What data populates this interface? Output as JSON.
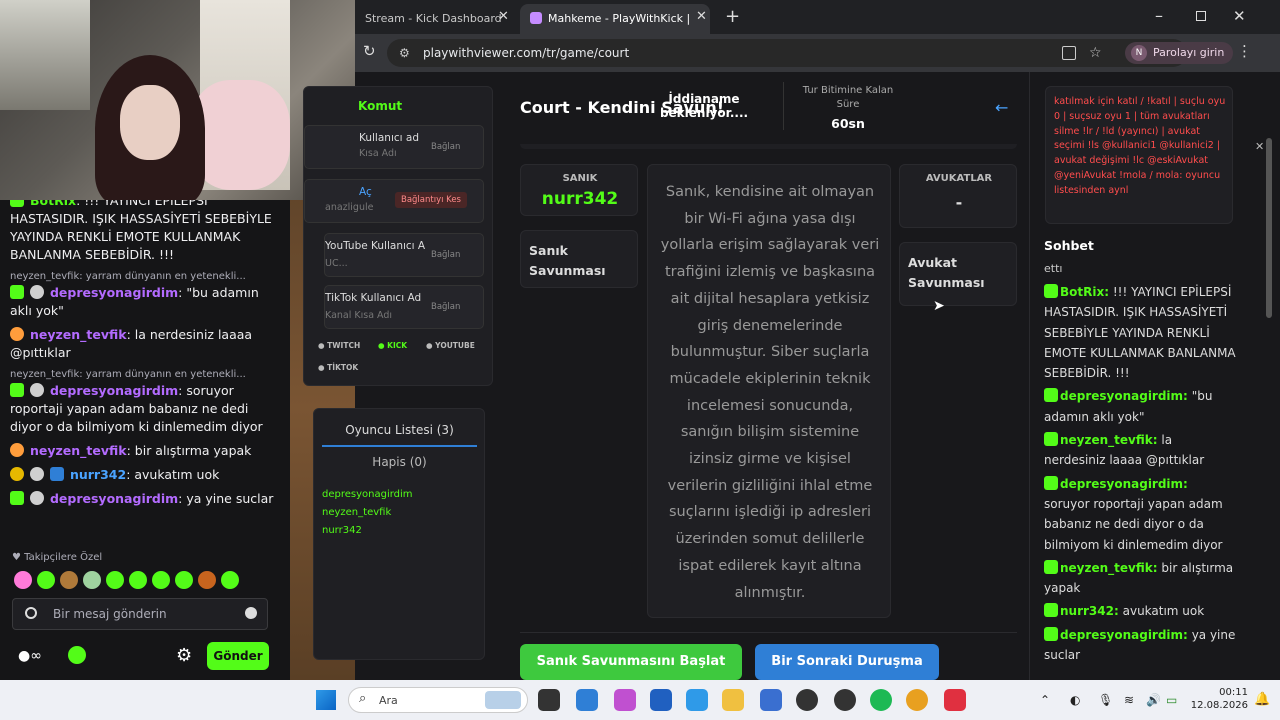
{
  "stream_chat": {
    "messages": [
      {
        "user": "BotRix",
        "text": "!!! YAYINCI EPİLEPSİ HASTASIDIR. IŞIK HASSASİYETİ SEBEBİYLE YAYINDA RENKLİ EMOTE KULLANMAK BANLANMA SEBEBİDİR. !!!"
      },
      {
        "reply": "neyzen_tevfik: yarram dünyanın en yetenekli...",
        "user": "depresyonagirdim",
        "text": "\"bu adamın aklı yok\""
      },
      {
        "user": "neyzen_tevfik",
        "text": "la nerdesiniz laaaa @pıttıklar"
      },
      {
        "reply": "neyzen_tevfik: yarram dünyanın en yetenekli...",
        "user": "depresyonagirdim",
        "text": "soruyor roportaji yapan adam babanız ne dedi diyor o da bilmiyom ki dinlemedim diyor"
      },
      {
        "user": "neyzen_tevfik",
        "text": "bir alıştırma yapak"
      },
      {
        "user": "nurr342",
        "text": "avukatım uok"
      },
      {
        "user": "depresyonagirdim",
        "text": "ya yine suclar"
      }
    ],
    "followers_only": "Takipçilere Özel",
    "input_placeholder": "Bir mesaj gönderin",
    "send_label": "Gönder",
    "colors": {
      "user_green": "#53fc18",
      "user_purple": "#b36bff",
      "user_blue": "#4aa3ff",
      "user_orange": "#ff9d3c"
    }
  },
  "browser": {
    "tab1": "Stream - Kick Dashboard",
    "tab2": "Mahkeme - PlayWithKick | Play",
    "url": "playwithviewer.com/tr/game/court",
    "password_btn": "Parolayı girin",
    "avatar_letter": "N"
  },
  "page": {
    "command_title": "Komut",
    "accounts": [
      {
        "name": "Kullanıcı ad",
        "sub": "Kısa Adı",
        "btn": "Bağlan"
      },
      {
        "name": "Aç",
        "sub": "anazligule",
        "btn": "Bağlantıyı Kes"
      },
      {
        "name": "YouTube Kullanıcı A",
        "sub": "UC...",
        "btn": "Bağlan"
      },
      {
        "name": "TikTok Kullanıcı Ad",
        "sub": "Kanal Kısa Adı",
        "btn": "Bağlan"
      }
    ],
    "platforms": [
      "TWITCH",
      "KICK",
      "YOUTUBE",
      "TİKTOK"
    ],
    "player_list_tab": "Oyuncu Listesi (3)",
    "prison_tab": "Hapis (0)",
    "players": [
      "depresyonagirdim",
      "neyzen_tevfik",
      "nurr342"
    ],
    "court_title": "Court - Kendini Savun!",
    "indictment": "İddianame bekleniyor....",
    "timer_label": "Tur Bitimine Kalan Süre",
    "timer_value": "60sn",
    "defendant_label": "SANIK",
    "defendant_name": "nurr342",
    "defendant_defense": "Sanık Savunması",
    "lawyers_label": "AVUKATLAR",
    "lawyers_value": "-",
    "lawyer_defense": "Avukat Savunması",
    "case_text": "Sanık, kendisine ait olmayan bir Wi-Fi ağına yasa dışı yollarla erişim sağlayarak veri trafiğini izlemiş ve başkasına ait dijital hesaplara yetkisiz giriş denemelerinde bulunmuştur. Siber suçlarla mücadele ekiplerinin teknik incelemesi sonucunda, sanığın bilişim sistemine izinsiz girme ve kişisel verilerin gizliliğini ihlal etme suçlarını işlediği ip adresleri üzerinden somut delillerle ispat edilerek kayıt altına alınmıştır.",
    "start_btn": "Sanık Savunmasını Başlat",
    "next_btn": "Bir Sonraki Duruşma",
    "info_text": "katılmak için katıl / !katıl | suçlu oyu 0 | suçsuz oyu 1 | tüm avukatları silme !lr / !ld (yayıncı) | avukat seçimi !ls @kullanici1 @kullanici2 | avukat değişimi !lc @eskiAvukat @yeniAvukat !mola / mola: oyuncu listesinden aynl",
    "chat_title": "Sohbet",
    "chat_partial": "ettı",
    "chat": [
      {
        "user": "BotRix:",
        "text": "!!! YAYINCI EPİLEPSİ HASTASIDIR. IŞIK HASSASİYETİ SEBEBİYLE YAYINDA RENKLİ EMOTE KULLANMAK BANLANMA SEBEBİDİR. !!!"
      },
      {
        "user": "depresyonagirdim:",
        "text": "\"bu adamın aklı yok\""
      },
      {
        "user": "neyzen_tevfik:",
        "text": "la nerdesiniz laaaa @pıttıklar"
      },
      {
        "user": "depresyonagirdim:",
        "text": "soruyor roportaji yapan adam babanız ne dedi diyor o da bilmiyom ki dinlemedim diyor"
      },
      {
        "user": "neyzen_tevfik:",
        "text": "bir alıştırma yapak"
      },
      {
        "user": "nurr342:",
        "text": "avukatım uok"
      },
      {
        "user": "depresyonagirdim:",
        "text": "ya yine suclar"
      }
    ],
    "colors": {
      "green": "#53fc18",
      "blue_btn": "#2f7fd6",
      "green_btn": "#3ec93e",
      "info_red": "#ff4d4d"
    }
  },
  "taskbar": {
    "search": "Ara",
    "time": "00:11",
    "date": "12.08.2026"
  }
}
